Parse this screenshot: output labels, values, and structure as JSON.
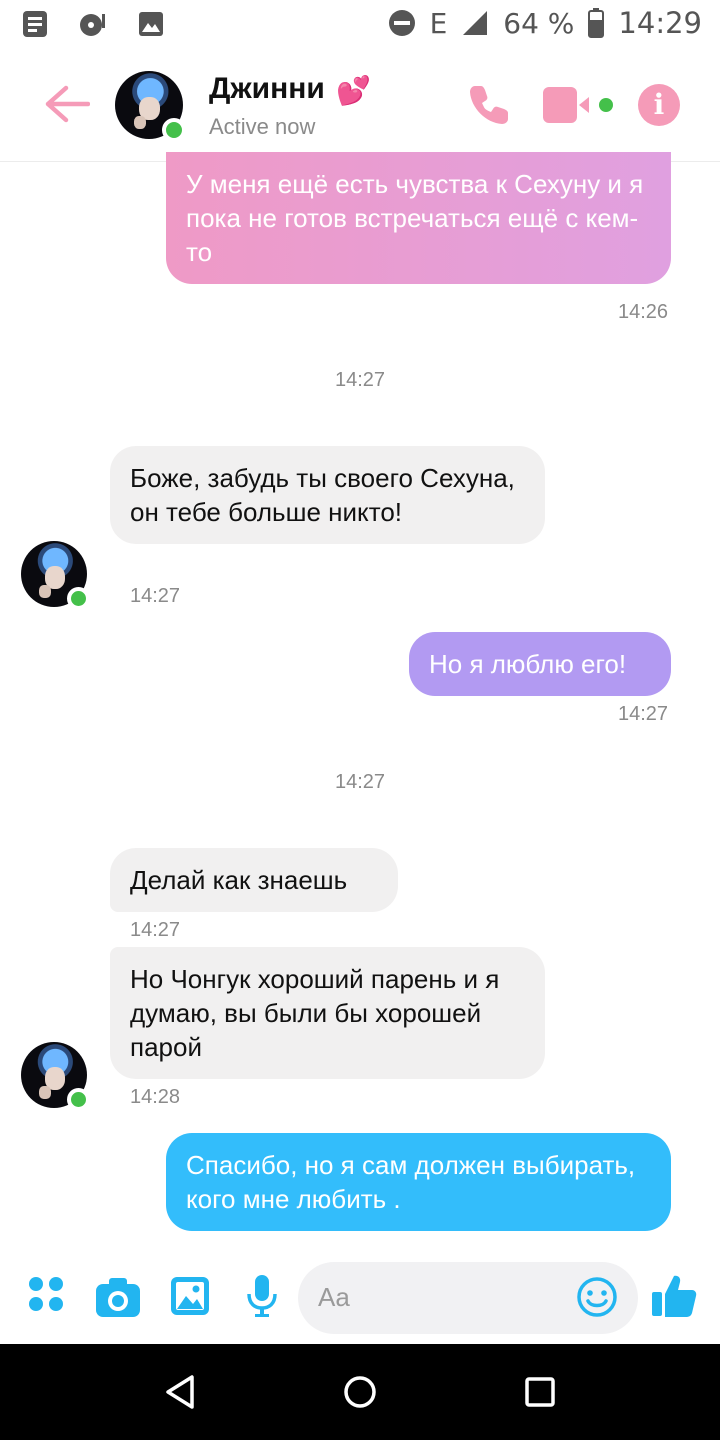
{
  "status_bar": {
    "signal_label": "E",
    "battery_percent": "64 %",
    "time": "14:29"
  },
  "header": {
    "contact_name": "Джинни",
    "heart_emoji": "💕",
    "status": "Active now"
  },
  "messages": [
    {
      "id": 1,
      "direction": "out",
      "text": "У меня ещё есть чувства к Сехуну и я пока не готов встречаться ещё с кем-то",
      "time": "14:26"
    },
    {
      "id": 2,
      "type": "separator",
      "text": "14:27"
    },
    {
      "id": 3,
      "direction": "in",
      "text": "Боже, забудь ты своего Сехуна, он тебе больше никто!",
      "time": "14:27"
    },
    {
      "id": 4,
      "direction": "out",
      "text": "Но я люблю его!",
      "time": "14:27"
    },
    {
      "id": 5,
      "type": "separator",
      "text": "14:27"
    },
    {
      "id": 6,
      "direction": "in",
      "text": "Делай как знаешь",
      "time": "14:27"
    },
    {
      "id": 7,
      "direction": "in",
      "text": "Но Чонгук хороший парень и я думаю, вы были бы хорошей парой",
      "time": "14:28"
    },
    {
      "id": 8,
      "direction": "out",
      "text": "Спасибо, но я сам должен выбирать, кого мне любить .",
      "time": ""
    }
  ],
  "composer": {
    "placeholder": "Aa",
    "icons": [
      "apps-icon",
      "camera-icon",
      "gallery-icon",
      "microphone-icon",
      "emoji-icon",
      "like-icon"
    ]
  },
  "colors": {
    "accent_pink": "#f59bb8",
    "bubble_pink_start": "#ef9ac6",
    "bubble_pink_end": "#e0a0e0",
    "bubble_purple": "#b29af2",
    "bubble_blue": "#33bdfb",
    "icon_blue": "#22b5f0",
    "online_green": "#44c04a"
  },
  "nav_bar": {
    "buttons": [
      "back-triangle-icon",
      "home-circle-icon",
      "recents-square-icon"
    ]
  }
}
